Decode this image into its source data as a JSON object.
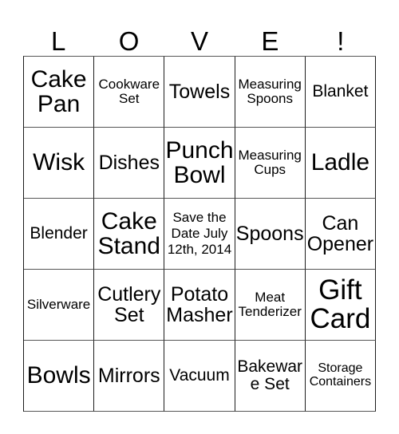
{
  "card": {
    "header_letters": [
      "L",
      "O",
      "V",
      "E",
      "!"
    ],
    "columns": 5,
    "rows": 5,
    "background_color": "#ffffff",
    "text_color": "#000000",
    "border_color": "#1c1c1c",
    "cells": [
      [
        {
          "text": "Cake Pan",
          "size": "lg"
        },
        {
          "text": "Cookware Set",
          "size": "xs"
        },
        {
          "text": "Towels",
          "size": "md"
        },
        {
          "text": "Measuring Spoons",
          "size": "xs"
        },
        {
          "text": "Blanket",
          "size": "sm"
        }
      ],
      [
        {
          "text": "Wisk",
          "size": "lg"
        },
        {
          "text": "Dishes",
          "size": "md"
        },
        {
          "text": "Punch Bowl",
          "size": "lg"
        },
        {
          "text": "Measuring Cups",
          "size": "xs"
        },
        {
          "text": "Ladle",
          "size": "lg"
        }
      ],
      [
        {
          "text": "Blender",
          "size": "sm"
        },
        {
          "text": "Cake Stand",
          "size": "lg"
        },
        {
          "text": "Save the Date July 12th, 2014",
          "size": "free"
        },
        {
          "text": "Spoons",
          "size": "md"
        },
        {
          "text": "Can Opener",
          "size": "md"
        }
      ],
      [
        {
          "text": "Silverware",
          "size": "xs"
        },
        {
          "text": "Cutlery Set",
          "size": "md"
        },
        {
          "text": "Potato Masher",
          "size": "md"
        },
        {
          "text": "Meat Tenderizer",
          "size": "xs"
        },
        {
          "text": "Gift Card",
          "size": "xl"
        }
      ],
      [
        {
          "text": "Bowls",
          "size": "lg"
        },
        {
          "text": "Mirrors",
          "size": "md"
        },
        {
          "text": "Vacuum",
          "size": "sm"
        },
        {
          "text": "Bakeware Set",
          "size": "sm"
        },
        {
          "text": "Storage Containers",
          "size": "xxs"
        }
      ]
    ]
  }
}
